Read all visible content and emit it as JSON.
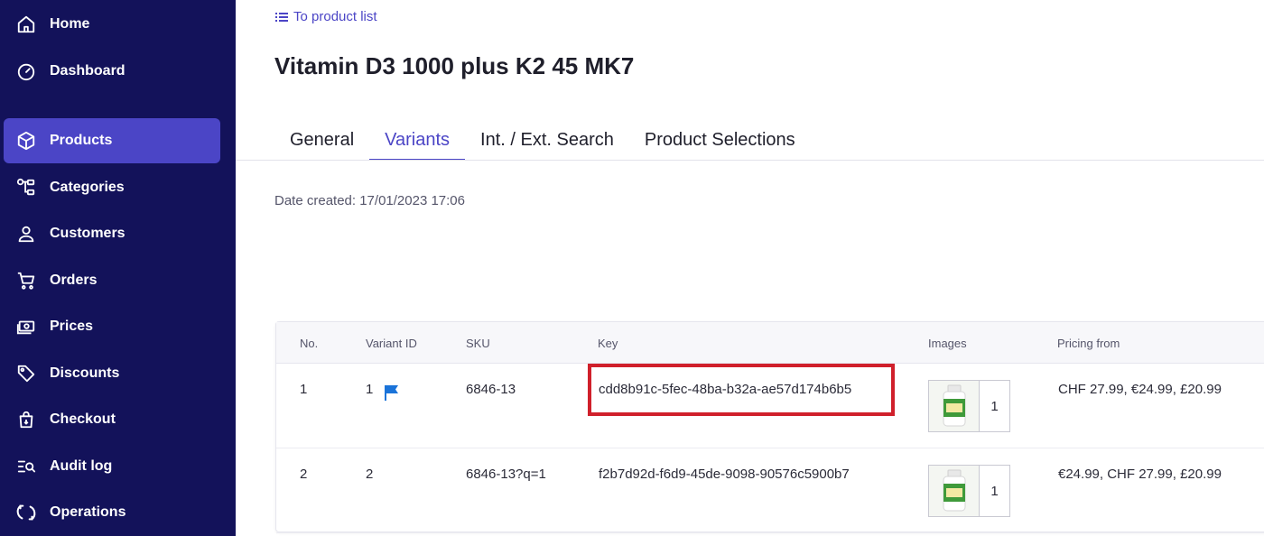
{
  "sidebar": {
    "items": [
      {
        "label": "Home",
        "icon": "home-icon"
      },
      {
        "label": "Dashboard",
        "icon": "gauge-icon"
      },
      {
        "label": "Products",
        "icon": "box-icon",
        "active": true
      },
      {
        "label": "Categories",
        "icon": "categories-icon"
      },
      {
        "label": "Customers",
        "icon": "user-icon"
      },
      {
        "label": "Orders",
        "icon": "cart-icon"
      },
      {
        "label": "Prices",
        "icon": "money-icon"
      },
      {
        "label": "Discounts",
        "icon": "tag-icon"
      },
      {
        "label": "Checkout",
        "icon": "checkout-icon"
      },
      {
        "label": "Audit log",
        "icon": "audit-icon"
      },
      {
        "label": "Operations",
        "icon": "sync-icon"
      }
    ]
  },
  "header": {
    "back_link": "To product list",
    "title": "Vitamin D3 1000 plus K2 45 MK7"
  },
  "tabs": [
    {
      "label": "General"
    },
    {
      "label": "Variants",
      "active": true
    },
    {
      "label": "Int. / Ext. Search"
    },
    {
      "label": "Product Selections"
    }
  ],
  "meta": {
    "date_created": "Date created: 17/01/2023 17:06"
  },
  "table": {
    "headers": {
      "no": "No.",
      "variant_id": "Variant ID",
      "sku": "SKU",
      "key": "Key",
      "images": "Images",
      "pricing": "Pricing from"
    },
    "rows": [
      {
        "no": "1",
        "variant_id": "1",
        "sku": "6846-13",
        "key": "cdd8b91c-5fec-48ba-b32a-ae57d174b6b5",
        "image_count": "1",
        "pricing": "CHF 27.99, €24.99, £20.99"
      },
      {
        "no": "2",
        "variant_id": "2",
        "sku": "6846-13?q=1",
        "key": "f2b7d92d-f6d9-45de-9098-90576c5900b7",
        "image_count": "1",
        "pricing": "€24.99, CHF 27.99, £20.99"
      }
    ]
  },
  "colors": {
    "sidebar_bg": "#13125a",
    "accent": "#4b45c6",
    "highlight": "#d0202b",
    "flag": "#1a73d9"
  }
}
